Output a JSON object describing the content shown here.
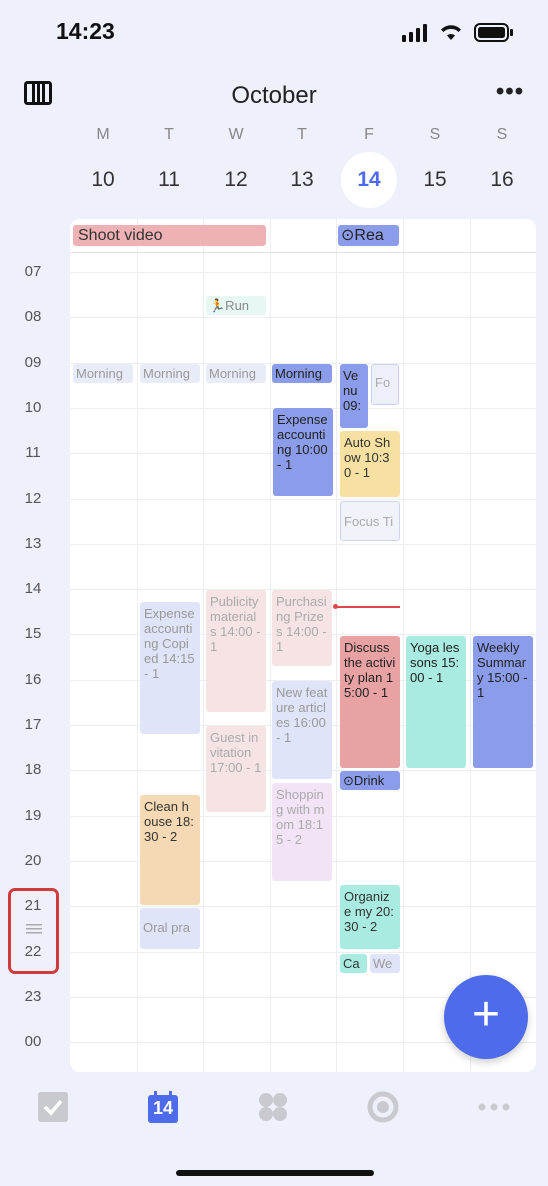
{
  "status": {
    "time": "14:23"
  },
  "header": {
    "title": "October"
  },
  "week": {
    "days": [
      {
        "dow": "M",
        "num": "10"
      },
      {
        "dow": "T",
        "num": "11"
      },
      {
        "dow": "W",
        "num": "12"
      },
      {
        "dow": "T",
        "num": "13"
      },
      {
        "dow": "F",
        "num": "14"
      },
      {
        "dow": "S",
        "num": "15"
      },
      {
        "dow": "S",
        "num": "16"
      }
    ],
    "today_index": 4
  },
  "allday": [
    {
      "label": "Shoot video"
    },
    {
      "label": "Rea"
    }
  ],
  "hours": [
    "07",
    "08",
    "09",
    "10",
    "11",
    "12",
    "13",
    "14",
    "15",
    "16",
    "17",
    "18",
    "19",
    "20",
    "21",
    "22",
    "23",
    "00"
  ],
  "events": {
    "run": "🏃Run",
    "morning": "Morning",
    "venue": "Venu 09:",
    "fo": "Fo",
    "expense13": "Expense accounting 10:00 - 1",
    "autoshow": "Auto Show 10:30 - 1",
    "focus": "Focus Ti",
    "expense_copied": "Expense accounting Copied 14:15 - 1",
    "publicity": "Publicity materials 14:00 - 1",
    "purchasing": "Purchasing Prizes 14:00 - 1",
    "discuss": "Discuss the activity plan 15:00 - 1",
    "yoga": "Yoga lessons 15:00 - 1",
    "weekly": "Weekly Summary 15:00 - 1",
    "newfeature": "New feature articles 16:00 - 1",
    "guest": "Guest invitation 17:00 - 1",
    "drink": "Drink",
    "clean": "Clean house 18:30 - 2",
    "shopping": "Shopping with mom 18:15 - 2",
    "oral": "Oral pra",
    "organize": "Organize my 20:30 - 2",
    "ca": "Ca",
    "we": "We"
  },
  "tabbar": {
    "calendar_day": "14"
  },
  "colors": {
    "accent": "#4d6bea",
    "now_line": "#e04848",
    "highlight": "#d23b3b"
  }
}
